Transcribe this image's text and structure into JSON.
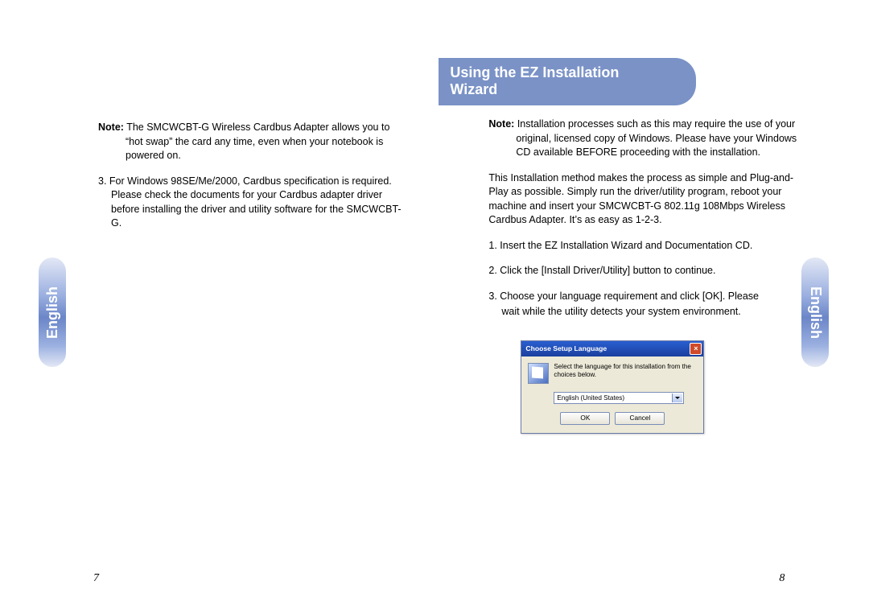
{
  "left": {
    "tab": "English",
    "note_label": "Note:",
    "note_body": "The SMCWCBT-G Wireless Cardbus Adapter allows you to “hot swap” the card any time, even when your notebook is powered on.",
    "item3": "3. For Windows 98SE/Me/2000, Cardbus specification is required. Please check the documents for your Cardbus adapter driver before installing the driver and utility software for the SMCWCBT-G.",
    "page_number": "7"
  },
  "right": {
    "tab": "English",
    "section_title_line1": "Using the EZ Installation",
    "section_title_line2": "Wizard",
    "note_label": "Note:",
    "note_body": "Installation processes such as this may require the use of your original, licensed copy of Windows. Please have your Windows CD available BEFORE proceeding with the installation.",
    "intro": "This Installation method makes the process as simple and Plug-and-Play as possible. Simply run the driver/utility program, reboot your machine and insert your SMCWCBT-G 802.11g 108Mbps Wireless Cardbus Adapter. It’s as easy as 1-2-3.",
    "step1": "1. Insert the EZ Installation Wizard and Documentation CD.",
    "step2": "2. Click the [Install Driver/Utility] button to continue.",
    "step3_a": "3. Choose your language requirement and click [OK]. Please",
    "step3_b": "wait while the utility detects your system environment.",
    "page_number": "8",
    "dialog": {
      "title": "Choose Setup Language",
      "message": "Select the language for this installation from the choices below.",
      "select_value": "English (United States)",
      "ok": "OK",
      "cancel": "Cancel"
    }
  }
}
